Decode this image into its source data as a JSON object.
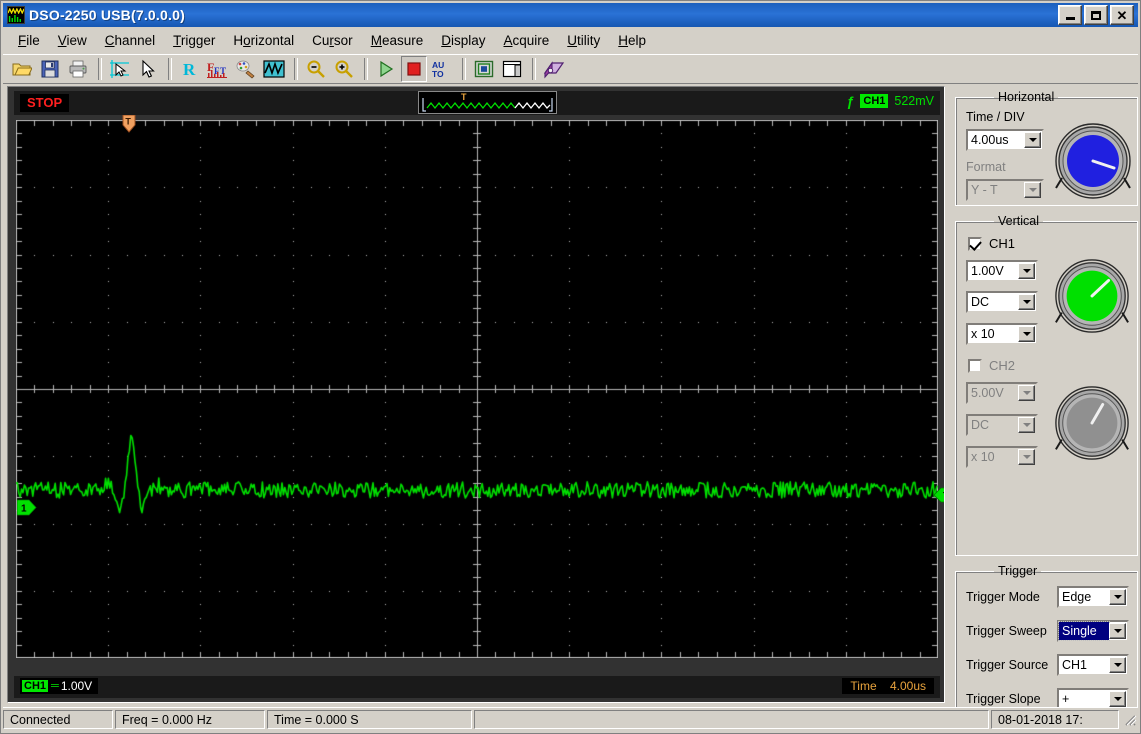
{
  "window": {
    "title": "DSO-2250 USB(7.0.0.0)",
    "icon": "scope-logo-icon",
    "buttons": {
      "minimize": "minimize-button",
      "maximize": "maximize-button",
      "close": "close-button"
    }
  },
  "menubar": {
    "items": [
      {
        "label": "File",
        "accel": "F"
      },
      {
        "label": "View",
        "accel": "V"
      },
      {
        "label": "Channel",
        "accel": "C"
      },
      {
        "label": "Trigger",
        "accel": "T"
      },
      {
        "label": "Horizontal",
        "accel": "o"
      },
      {
        "label": "Cursor",
        "accel": "r"
      },
      {
        "label": "Measure",
        "accel": "M"
      },
      {
        "label": "Display",
        "accel": "D"
      },
      {
        "label": "Acquire",
        "accel": "A"
      },
      {
        "label": "Utility",
        "accel": "U"
      },
      {
        "label": "Help",
        "accel": "H"
      }
    ]
  },
  "toolbar": {
    "buttons": [
      {
        "name": "open-icon",
        "tip": "Open"
      },
      {
        "name": "save-icon",
        "tip": "Save"
      },
      {
        "name": "print-icon",
        "tip": "Print"
      },
      {
        "name": "cursor-measure-icon",
        "tip": "Cursor Measure"
      },
      {
        "name": "pointer-icon",
        "tip": "Select"
      },
      {
        "name": "reference-icon",
        "tip": "Reference"
      },
      {
        "name": "fft-icon",
        "tip": "FFT"
      },
      {
        "name": "persistence-icon",
        "tip": "Persistence"
      },
      {
        "name": "waveform-math-icon",
        "tip": "Waveform Math"
      },
      {
        "name": "zoom-out-icon",
        "tip": "Zoom Out"
      },
      {
        "name": "zoom-in-icon",
        "tip": "Zoom In"
      },
      {
        "name": "run-icon",
        "tip": "Run"
      },
      {
        "name": "stop-icon",
        "tip": "Stop"
      },
      {
        "name": "auto-icon",
        "tip": "AUTO"
      },
      {
        "name": "fullscreen-icon",
        "tip": "Full Screen"
      },
      {
        "name": "panel-toggle-icon",
        "tip": "Toggle Panel"
      },
      {
        "name": "help-book-icon",
        "tip": "Help"
      }
    ]
  },
  "scope": {
    "run_state": "STOP",
    "trigger_marker": "T",
    "channel_readout": {
      "slope": "ƒ",
      "channel": "CH1",
      "level": "522mV"
    },
    "ground_marker": "1",
    "trigger_level_marker": "T",
    "bottom": {
      "channel_label": "CH1",
      "coupling_symbol": "═",
      "volts_per_div": "1.00V",
      "time_label": "Time",
      "time_per_div": "4.00us"
    },
    "grid": {
      "columns": 10,
      "rows": 8,
      "color": "#b8b8b8",
      "background": "#000000"
    },
    "waveform": {
      "color": "#00e000",
      "baseline_div_from_top": 5.5,
      "noise_amplitude_div": 0.12,
      "glitch_center_div": 1.25,
      "glitch_peak_div": 0.85
    }
  },
  "panel": {
    "horizontal": {
      "title": "Horizontal",
      "time_div_label": "Time / DIV",
      "time_div_value": "4.00us",
      "format_label": "Format",
      "format_value": "Y - T",
      "format_disabled": true,
      "knob_color": "#2020e0"
    },
    "vertical": {
      "title": "Vertical",
      "ch1": {
        "label": "CH1",
        "enabled": true,
        "volts_div": "1.00V",
        "coupling": "DC",
        "probe": "x 10",
        "knob_color": "#00e000"
      },
      "ch2": {
        "label": "CH2",
        "enabled": false,
        "volts_div": "5.00V",
        "coupling": "DC",
        "probe": "x 10",
        "knob_color": "#909090"
      }
    },
    "trigger": {
      "title": "Trigger",
      "rows": [
        {
          "label": "Trigger Mode",
          "value": "Edge",
          "selected": false
        },
        {
          "label": "Trigger Sweep",
          "value": "Single",
          "selected": true
        },
        {
          "label": "Trigger Source",
          "value": "CH1",
          "selected": false
        },
        {
          "label": "Trigger Slope",
          "value": "+",
          "selected": false
        }
      ]
    }
  },
  "statusbar": {
    "connection": "Connected",
    "freq": "Freq = 0.000 Hz",
    "time": "Time = 0.000 S",
    "datetime": "08-01-2018  17:"
  }
}
